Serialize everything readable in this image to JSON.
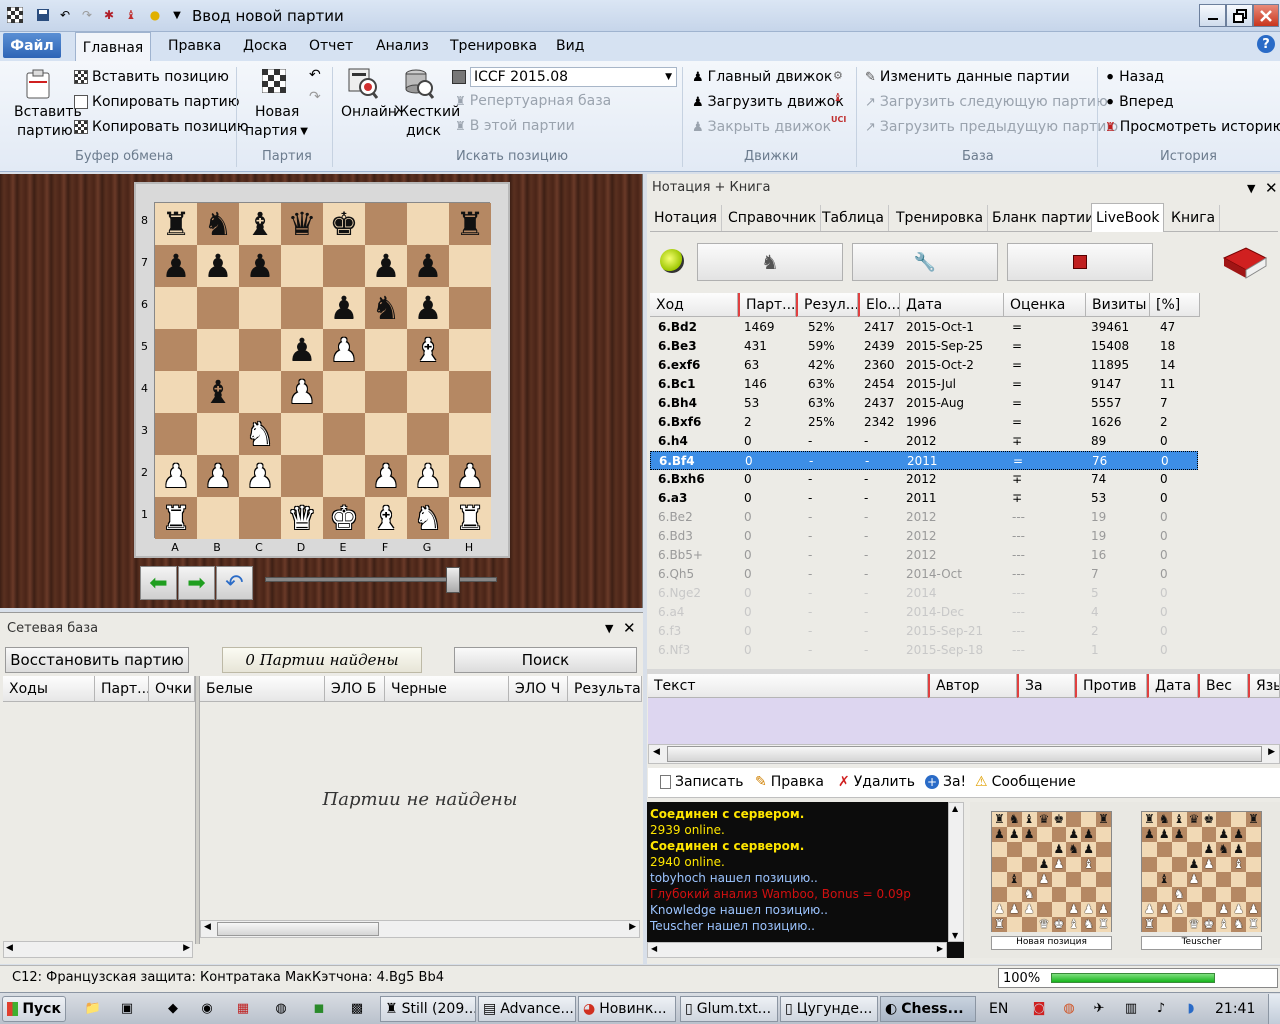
{
  "window": {
    "title": "Ввод новой партии"
  },
  "colors": {
    "accent": "#2d64b6",
    "selection": "#3d8ee6",
    "light_square": "#f1d9b5",
    "dark_square": "#b58863",
    "progress": "#16b41c"
  },
  "ribbon": {
    "file_tab": "Файл",
    "tabs": [
      "Главная",
      "Правка",
      "Доска",
      "Отчет",
      "Анализ",
      "Тренировка",
      "Вид"
    ],
    "clipboard": {
      "paste_game": "Вставить",
      "paste_game2": "партию",
      "paste_position": "Вставить позицию",
      "copy_game": "Копировать партию",
      "copy_position": "Копировать позицию",
      "group": "Буфер обмена"
    },
    "game": {
      "new_game": "Новая",
      "new_game2": "партия",
      "group": "Партия"
    },
    "search": {
      "online": "Онлайн",
      "hdd": "Жесткий",
      "hdd2": "диск",
      "db_select": "ICCF 2015.08",
      "rep_base": "Репертуарная база",
      "in_game": "В этой партии",
      "group": "Искать позицию"
    },
    "engines": {
      "main_engine": "Главный движок",
      "load_engine": "Загрузить движок",
      "close_engine": "Закрыть движок",
      "group": "Движки"
    },
    "base": {
      "edit_data": "Изменить данные партии",
      "load_next": "Загрузить следующую партию",
      "load_prev": "Загрузить предыдущую партию",
      "group": "База"
    },
    "history": {
      "back": "Назад",
      "forward": "Вперед",
      "view_history": "Просмотреть историю",
      "group": "История"
    }
  },
  "board": {
    "ranks": [
      "8",
      "7",
      "6",
      "5",
      "4",
      "3",
      "2",
      "1"
    ],
    "files": [
      "A",
      "B",
      "C",
      "D",
      "E",
      "F",
      "G",
      "H"
    ],
    "position": [
      [
        "br",
        "bn",
        "bb",
        "bq",
        "bk",
        "",
        "",
        "br"
      ],
      [
        "bp",
        "bp",
        "bp",
        "",
        "",
        "bp",
        "bp",
        ""
      ],
      [
        "",
        "",
        "",
        "",
        "bp",
        "bn",
        "bp",
        ""
      ],
      [
        "",
        "",
        "",
        "bp",
        "wp",
        "",
        "wb",
        ""
      ],
      [
        "",
        "bb",
        "",
        "wp",
        "",
        "",
        "",
        ""
      ],
      [
        "",
        "",
        "wn",
        "",
        "",
        "",
        "",
        ""
      ],
      [
        "wp",
        "wp",
        "wp",
        "",
        "",
        "wp",
        "wp",
        "wp"
      ],
      [
        "wr",
        "",
        "",
        "wq",
        "wk",
        "wb",
        "wn",
        "wr"
      ]
    ]
  },
  "network": {
    "title": "Сетевая база",
    "restore_button": "Восстановить партию",
    "found_count": "0 Партии найдены",
    "search_button": "Поиск",
    "left_cols": [
      "Ходы",
      "Парт...",
      "Очки"
    ],
    "right_cols": [
      "Белые",
      "ЭЛО Б",
      "Черные",
      "ЭЛО Ч",
      "Результат"
    ],
    "empty_message": "Партии не найдены"
  },
  "notation": {
    "title": "Нотация + Книга",
    "tabs": [
      "Нотация",
      "Справочник",
      "Таблица",
      "Тренировка",
      "Бланк партии",
      "LiveBook",
      "Книга"
    ],
    "active_tab": "LiveBook",
    "columns": [
      "Ход",
      "Парт...",
      "Резул...",
      "Elo...",
      "Дата",
      "Оценка",
      "Визиты",
      "[%]"
    ],
    "moves": [
      {
        "move": "6.Bd2",
        "games": "1469",
        "result": "52%",
        "elo": "2417",
        "date": "2015-Oct-1",
        "eval": "=",
        "visits": "39461",
        "pct": "47",
        "style": "b"
      },
      {
        "move": "6.Be3",
        "games": "431",
        "result": "59%",
        "elo": "2439",
        "date": "2015-Sep-25",
        "eval": "=",
        "visits": "15408",
        "pct": "18",
        "style": "b"
      },
      {
        "move": "6.exf6",
        "games": "63",
        "result": "42%",
        "elo": "2360",
        "date": "2015-Oct-2",
        "eval": "=",
        "visits": "11895",
        "pct": "14",
        "style": "b"
      },
      {
        "move": "6.Bc1",
        "games": "146",
        "result": "63%",
        "elo": "2454",
        "date": "2015-Jul",
        "eval": "=",
        "visits": "9147",
        "pct": "11",
        "style": "b"
      },
      {
        "move": "6.Bh4",
        "games": "53",
        "result": "63%",
        "elo": "2437",
        "date": "2015-Aug",
        "eval": "=",
        "visits": "5557",
        "pct": "7",
        "style": "b"
      },
      {
        "move": "6.Bxf6",
        "games": "2",
        "result": "25%",
        "elo": "2342",
        "date": "1996",
        "eval": "=",
        "visits": "1626",
        "pct": "2",
        "style": "b"
      },
      {
        "move": "6.h4",
        "games": "0",
        "result": "-",
        "elo": "-",
        "date": "2012",
        "eval": "∓",
        "visits": "89",
        "pct": "0",
        "style": "b"
      },
      {
        "move": "6.Bf4",
        "games": "0",
        "result": "-",
        "elo": "-",
        "date": "2011",
        "eval": "=",
        "visits": "76",
        "pct": "0",
        "style": "sel"
      },
      {
        "move": "6.Bxh6",
        "games": "0",
        "result": "-",
        "elo": "-",
        "date": "2012",
        "eval": "∓",
        "visits": "74",
        "pct": "0",
        "style": "b"
      },
      {
        "move": "6.a3",
        "games": "0",
        "result": "-",
        "elo": "-",
        "date": "2011",
        "eval": "∓",
        "visits": "53",
        "pct": "0",
        "style": "b"
      },
      {
        "move": "6.Be2",
        "games": "0",
        "result": "-",
        "elo": "-",
        "date": "2012",
        "eval": "---",
        "visits": "19",
        "pct": "0",
        "style": "gr"
      },
      {
        "move": "6.Bd3",
        "games": "0",
        "result": "-",
        "elo": "-",
        "date": "2012",
        "eval": "---",
        "visits": "19",
        "pct": "0",
        "style": "gr"
      },
      {
        "move": "6.Bb5+",
        "games": "0",
        "result": "-",
        "elo": "-",
        "date": "2012",
        "eval": "---",
        "visits": "16",
        "pct": "0",
        "style": "gr"
      },
      {
        "move": "6.Qh5",
        "games": "0",
        "result": "-",
        "elo": "-",
        "date": "2014-Oct",
        "eval": "---",
        "visits": "7",
        "pct": "0",
        "style": "gr"
      },
      {
        "move": "6.Nge2",
        "games": "0",
        "result": "-",
        "elo": "-",
        "date": "2014",
        "eval": "---",
        "visits": "5",
        "pct": "0",
        "style": "fa"
      },
      {
        "move": "6.a4",
        "games": "0",
        "result": "-",
        "elo": "-",
        "date": "2014-Dec",
        "eval": "---",
        "visits": "4",
        "pct": "0",
        "style": "fa"
      },
      {
        "move": "6.f3",
        "games": "0",
        "result": "-",
        "elo": "-",
        "date": "2015-Sep-21",
        "eval": "---",
        "visits": "2",
        "pct": "0",
        "style": "fa"
      },
      {
        "move": "6.Nf3",
        "games": "0",
        "result": "-",
        "elo": "-",
        "date": "2015-Sep-18",
        "eval": "---",
        "visits": "1",
        "pct": "0",
        "style": "fa"
      }
    ]
  },
  "comments": {
    "columns": [
      "Текст",
      "Автор",
      "За",
      "Против",
      "Дата",
      "Вес",
      "Язы"
    ],
    "actions": {
      "write": "Записать",
      "edit": "Правка",
      "delete": "Удалить",
      "plus": "За!",
      "message": "Сообщение"
    }
  },
  "chat": [
    {
      "text": "Соединен с сервером.",
      "color": "#ffe600",
      "bold": true
    },
    {
      "text": "2939 online.",
      "color": "#ffe600",
      "bold": false
    },
    {
      "text": "Соединен с сервером.",
      "color": "#ffe600",
      "bold": true
    },
    {
      "text": "2940 online.",
      "color": "#ffe600",
      "bold": false
    },
    {
      "text": "tobyhoch нашел позицию..",
      "color": "#9cc4ff",
      "bold": false
    },
    {
      "text": "Глубокий анализ Wamboo, Bonus = 0.09p",
      "color": "#d01010",
      "bold": false
    },
    {
      "text": "Knowledge нашел позицию..",
      "color": "#9cc4ff",
      "bold": false
    },
    {
      "text": "Teuscher нашел позицию..",
      "color": "#9cc4ff",
      "bold": false
    }
  ],
  "thumbs": {
    "left_caption": "Новая позиция",
    "right_caption": "Teuscher"
  },
  "status": {
    "opening": "C12: Французская защита: Контратака МакКэтчона: 4.Bg5 Bb4",
    "progress_label": "100%",
    "progress": 1.0
  },
  "taskbar": {
    "start": "Пуск",
    "items": [
      "Still (209...",
      "Advance...",
      "Новинк...",
      "Glum.txt...",
      "Цугунде...",
      "Chess..."
    ],
    "lang": "EN",
    "clock": "21:41"
  }
}
